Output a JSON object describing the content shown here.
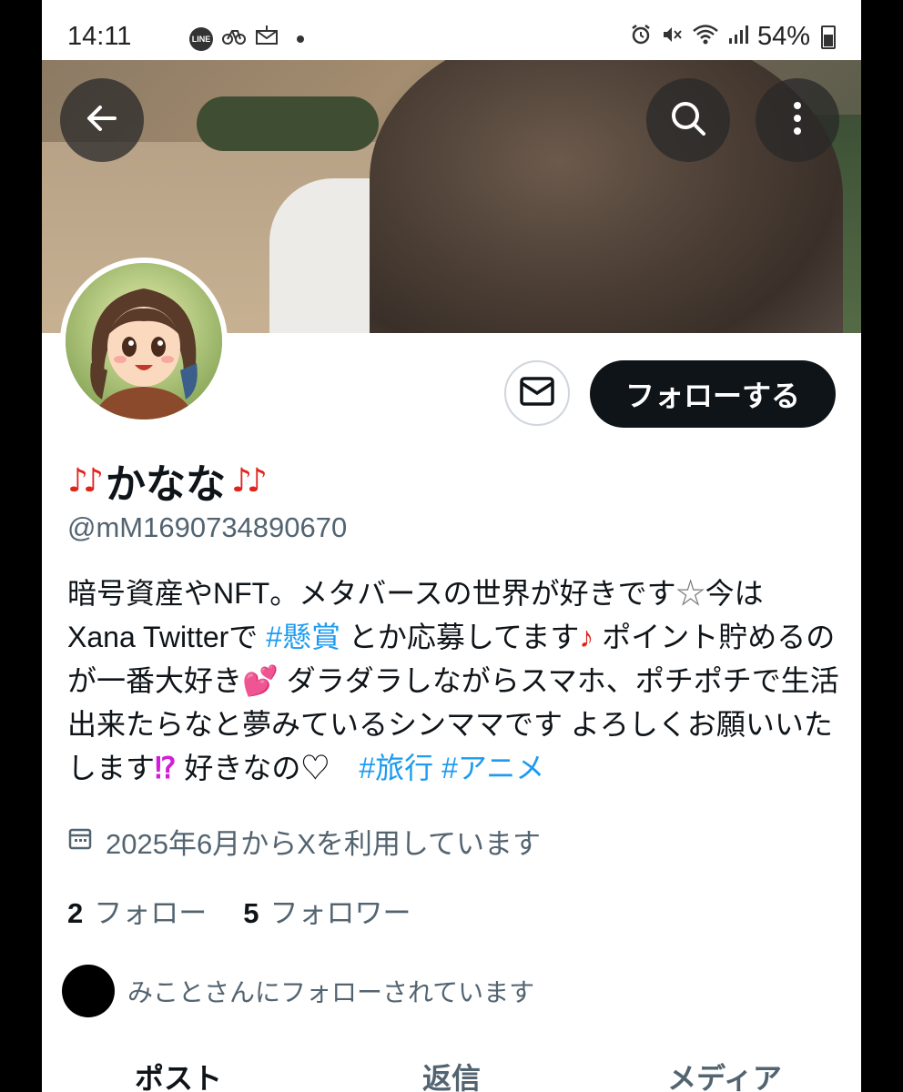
{
  "status_bar": {
    "time": "14:11",
    "line_badge": "LINE",
    "battery": "54%",
    "icons": [
      "line-icon",
      "bike-icon",
      "mail-icon",
      "alarm-icon",
      "mute-icon",
      "wifi-icon",
      "signal-icon",
      "battery-icon"
    ]
  },
  "header": {
    "back_icon": "back-arrow-icon",
    "search_icon": "search-icon",
    "more_icon": "more-vertical-icon"
  },
  "profile": {
    "name": "かなな",
    "name_decoration": "♪♪",
    "handle": "@mM1690734890670",
    "follow_button": "フォローする",
    "bio": {
      "seg1": "暗号資産やNFT。メタバースの世界が好きです",
      "star": "☆",
      "seg2": "今は",
      "seg3": "Xana Twitterで ",
      "tag1": "#懸賞",
      "seg4": " とか応募してます",
      "note": "♪",
      "seg5": " ポイント貯めるのが一番大好き",
      "hearts": "💕",
      "seg6": " ダラダラしながらスマホ、ポチポチで生活出来たらなと夢みているシンママです よろしくお願いいたします",
      "exq": "⁉",
      "seg7": " 好きなの♡　",
      "tag2": "#旅行",
      "tag3": "#アニメ"
    },
    "joined": "2025年6月からXを利用しています",
    "following_count": "2",
    "following_label": "フォロー",
    "followers_count": "5",
    "followers_label": "フォロワー",
    "followed_by": "みことさんにフォローされています"
  },
  "tabs": [
    {
      "label": "ポスト",
      "active": true
    },
    {
      "label": "返信",
      "active": false
    },
    {
      "label": "メディア",
      "active": false
    }
  ],
  "colors": {
    "accent_link": "#1d9bf0",
    "follow_button_bg": "#0f1419",
    "secondary_text": "#536471"
  }
}
